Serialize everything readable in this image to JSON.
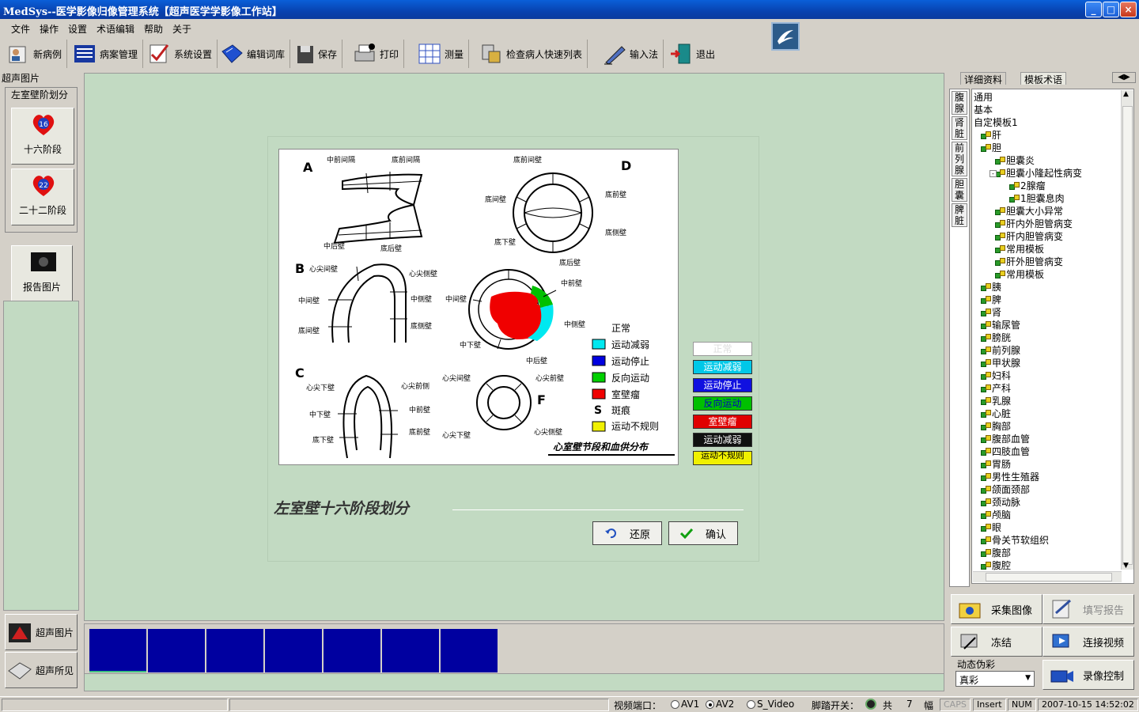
{
  "window": {
    "title": "MedSys--医学影像归像管理系统【超声医学学影像工作站】",
    "min": "_",
    "max": "□",
    "close": "×"
  },
  "menu": [
    "文件",
    "操作",
    "设置",
    "术语编辑",
    "帮助",
    "关于"
  ],
  "toolbar": [
    "新病例",
    "病案管理",
    "系统设置",
    "编辑词库",
    "保存",
    "打印",
    "测量",
    "检查病人快速列表",
    "输入法",
    "退出"
  ],
  "left_panel": {
    "header": "超声图片",
    "group_title": "左室壁阶划分",
    "btn16": {
      "badge": "16",
      "label": "十六阶段"
    },
    "btn22": {
      "badge": "22",
      "label": "二十二阶段"
    },
    "report_btn": "报告图片",
    "ultrasound_images": "超声图片",
    "ultrasound_findings": "超声所见"
  },
  "figure": {
    "labels": {
      "A": "A",
      "B": "B",
      "C": "C",
      "D": "D",
      "F": "F",
      "a1": "中前间隔",
      "a2": "底前间隔",
      "a3": "中后壁",
      "a4": "底后壁",
      "d1": "底前间壁",
      "d2": "底间壁",
      "d3": "底前壁",
      "d4": "底下壁",
      "d5": "底侧壁",
      "d6": "底后壁",
      "b1": "心尖间壁",
      "b2": "心尖侧壁",
      "b3": "中间壁",
      "b4": "中侧壁",
      "b5": "底间壁",
      "b6": "底侧壁",
      "e1": "中间壁",
      "e2": "中前壁",
      "e3": "中侧壁",
      "e4": "中下壁",
      "e5": "中后壁",
      "c1": "心尖下壁",
      "c2": "心尖前侧",
      "c3": "中下壁",
      "c4": "中前壁",
      "c5": "底下壁",
      "c6": "底前壁",
      "f1": "心尖间壁",
      "f2": "心尖前壁",
      "f3": "心尖下壁",
      "f4": "心尖侧壁"
    },
    "legend": [
      {
        "label": "正常",
        "color": ""
      },
      {
        "label": "运动减弱",
        "color": "#00e8f0"
      },
      {
        "label": "运动停止",
        "color": "#0000e0"
      },
      {
        "label": "反向运动",
        "color": "#00d000"
      },
      {
        "label": "室壁瘤",
        "color": "#f00000"
      },
      {
        "label": "斑痕",
        "color": "",
        "symbol": "S"
      },
      {
        "label": "运动不规则",
        "color": "#f0f000"
      }
    ],
    "footer": "心室壁节段和血供分布"
  },
  "legend_buttons": [
    {
      "label": "正常",
      "bg": "#ffffff",
      "fg": "#dddddd"
    },
    {
      "label": "运动减弱",
      "bg": "#00c8e8",
      "fg": "#ffffff"
    },
    {
      "label": "运动停止",
      "bg": "#1010e0",
      "fg": "#ffffff"
    },
    {
      "label": "反向运动",
      "bg": "#00c000",
      "fg": "#0000c0"
    },
    {
      "label": "室壁瘤",
      "bg": "#e00000",
      "fg": "#ffffff"
    },
    {
      "label": "运动减弱",
      "bg": "#101010",
      "fg": "#ffffff"
    },
    {
      "label": "运动不规则",
      "bg": "#f0f000",
      "fg": "#000000"
    }
  ],
  "caption": "左室壁十六阶段划分",
  "dialog": {
    "restore": "还原",
    "confirm": "确认"
  },
  "right_panel": {
    "tabs": [
      "详细资料",
      "模板术语"
    ],
    "vtabs": [
      "腹腺",
      "肾脏",
      "前列腺",
      "胆囊",
      "脾脏"
    ],
    "tree": [
      {
        "label": "通用",
        "indent": 0,
        "icon": false
      },
      {
        "label": "基本",
        "indent": 0,
        "icon": false
      },
      {
        "label": "自定模板1",
        "indent": 0,
        "icon": false
      },
      {
        "label": "肝",
        "indent": 1,
        "icon": true
      },
      {
        "label": "胆",
        "indent": 1,
        "icon": true
      },
      {
        "label": "胆囊炎",
        "indent": 3,
        "icon": true
      },
      {
        "label": "胆囊小隆起性病变",
        "indent": 3,
        "icon": true
      },
      {
        "label": "2腺瘤",
        "indent": 5,
        "icon": true
      },
      {
        "label": "1胆囊息肉",
        "indent": 5,
        "icon": true
      },
      {
        "label": "胆囊大小异常",
        "indent": 3,
        "icon": true
      },
      {
        "label": "肝内外胆管病变",
        "indent": 3,
        "icon": true
      },
      {
        "label": "肝内胆管病变",
        "indent": 3,
        "icon": true
      },
      {
        "label": "常用模板",
        "indent": 3,
        "icon": true
      },
      {
        "label": "肝外胆管病变",
        "indent": 3,
        "icon": true
      },
      {
        "label": "常用模板",
        "indent": 3,
        "icon": true
      },
      {
        "label": "胰",
        "indent": 1,
        "icon": true
      },
      {
        "label": "脾",
        "indent": 1,
        "icon": true
      },
      {
        "label": "肾",
        "indent": 1,
        "icon": true
      },
      {
        "label": "输尿管",
        "indent": 1,
        "icon": true
      },
      {
        "label": "膀胱",
        "indent": 1,
        "icon": true
      },
      {
        "label": "前列腺",
        "indent": 1,
        "icon": true
      },
      {
        "label": "甲状腺",
        "indent": 1,
        "icon": true
      },
      {
        "label": "妇科",
        "indent": 1,
        "icon": true
      },
      {
        "label": "产科",
        "indent": 1,
        "icon": true
      },
      {
        "label": "乳腺",
        "indent": 1,
        "icon": true
      },
      {
        "label": "心脏",
        "indent": 1,
        "icon": true
      },
      {
        "label": "胸部",
        "indent": 1,
        "icon": true
      },
      {
        "label": "腹部血管",
        "indent": 1,
        "icon": true
      },
      {
        "label": "四肢血管",
        "indent": 1,
        "icon": true
      },
      {
        "label": "胃肠",
        "indent": 1,
        "icon": true
      },
      {
        "label": "男性生殖器",
        "indent": 1,
        "icon": true
      },
      {
        "label": "颌面颈部",
        "indent": 1,
        "icon": true
      },
      {
        "label": "颈动脉",
        "indent": 1,
        "icon": true
      },
      {
        "label": "颅脑",
        "indent": 1,
        "icon": true
      },
      {
        "label": "眼",
        "indent": 1,
        "icon": true
      },
      {
        "label": "骨关节软组织",
        "indent": 1,
        "icon": true
      },
      {
        "label": "腹部",
        "indent": 1,
        "icon": true
      },
      {
        "label": "腹腔",
        "indent": 1,
        "icon": true
      }
    ]
  },
  "controls": {
    "capture": "采集图像",
    "fill_report": "填写报告",
    "freeze": "冻结",
    "continuous_video": "连接视频",
    "dynamic_color_label": "动态伪彩",
    "color_value": "真彩",
    "record_control": "录像控制"
  },
  "statusbar": {
    "video_port": "视频端口：",
    "av1": "AV1",
    "av2": "AV2",
    "svideo": "S_Video",
    "foot_switch": "脚踏开关：",
    "total": "共",
    "count": "7",
    "unit": "幅",
    "caps": "CAPS",
    "insert": "Insert",
    "num": "NUM",
    "datetime": "2007-10-15  14:52:02"
  }
}
